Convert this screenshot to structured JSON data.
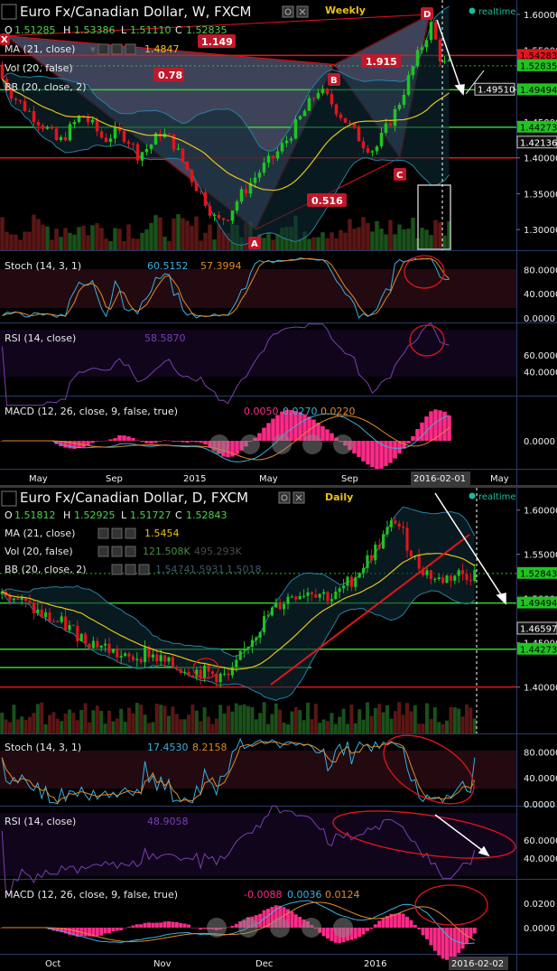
{
  "colors": {
    "background": "#000000",
    "panel_border": "#2b3b66",
    "bull": "#21c321",
    "bear": "#e3141d",
    "ma": "#e8c21a",
    "bb": "#2a7fa0",
    "stoch_k": "#3ab0e0",
    "stoch_d": "#e08a2a",
    "rsi": "#7b3fb0",
    "macd_hist": "#ff2a88",
    "green_line": "#33d433",
    "red_line": "#e3141d",
    "pattern_fill": "#8d94c8",
    "realtime_dot": "#1abc9c"
  },
  "charts": [
    {
      "id": "weekly",
      "title": "Euro Fx/Canadian Dollar, W, FXCM",
      "timeframe_label": "Weekly",
      "realtime_label": "realtime",
      "ohlc": {
        "o_label": "O",
        "o": "1.51285",
        "h_label": "H",
        "h": "1.53386",
        "l_label": "L",
        "l": "1.51110",
        "c_label": "C",
        "c": "1.52835"
      },
      "indicators": {
        "ma": {
          "label": "MA (21, close)",
          "value": "1.4847"
        },
        "vol": {
          "label": "Vol (20, false)",
          "value": ""
        },
        "bb": {
          "label": "BB (20, close, 2)",
          "value": ""
        },
        "stoch": {
          "label": "Stoch (14, 3, 1)",
          "k": "60.5152",
          "d": "57.3994"
        },
        "rsi": {
          "label": "RSI (14, close)",
          "value": "58.5870"
        },
        "macd": {
          "label": "MACD (12, 26, close, 9, false, true)",
          "hist": "0.0050",
          "macd": "0.0270",
          "signal": "0.0220"
        }
      },
      "harmonic_labels": {
        "x": "X",
        "a": "A",
        "b": "B",
        "c": "C",
        "d": "D"
      },
      "ratios": {
        "xab": "0.78",
        "xad": "1.149",
        "bcd": "1.915",
        "abc": "0.516"
      },
      "price_axis": [
        "1.60000",
        "1.55000",
        "1.50000",
        "1.45000",
        "1.40000",
        "1.35000",
        "1.30000"
      ],
      "price_tags": [
        {
          "text": "1.54283",
          "kind": "red"
        },
        {
          "text": "1.52835",
          "kind": "green"
        },
        {
          "text": "1.49510",
          "kind": "white"
        },
        {
          "text": "1.49494",
          "kind": "green"
        },
        {
          "text": "1.44273",
          "kind": "green"
        },
        {
          "text": "1.42136",
          "kind": "white"
        }
      ],
      "stoch_axis": [
        "80.0000",
        "40.0000",
        "0.0000"
      ],
      "rsi_axis": [
        "60.0000",
        "40.0000"
      ],
      "macd_axis": [
        "0.0000"
      ],
      "time_axis": [
        "May",
        "Sep",
        "2015",
        "May",
        "Sep",
        "2016-02-01",
        "May"
      ],
      "chart_data": {
        "type": "candlestick",
        "ylim": [
          1.28,
          1.61
        ],
        "ohlc_overview": [
          [
            1.53,
            1.535,
            1.5,
            1.51
          ],
          [
            1.51,
            1.512,
            1.48,
            1.485
          ],
          [
            1.485,
            1.49,
            1.46,
            1.47
          ],
          [
            1.47,
            1.48,
            1.445,
            1.455
          ],
          [
            1.455,
            1.465,
            1.43,
            1.44
          ],
          [
            1.44,
            1.45,
            1.41,
            1.42
          ],
          [
            1.42,
            1.445,
            1.41,
            1.44
          ],
          [
            1.44,
            1.47,
            1.43,
            1.46
          ],
          [
            1.46,
            1.47,
            1.44,
            1.445
          ],
          [
            1.445,
            1.45,
            1.42,
            1.425
          ],
          [
            1.425,
            1.44,
            1.41,
            1.435
          ],
          [
            1.435,
            1.45,
            1.42,
            1.43
          ],
          [
            1.43,
            1.44,
            1.4,
            1.405
          ],
          [
            1.405,
            1.42,
            1.39,
            1.415
          ],
          [
            1.415,
            1.44,
            1.41,
            1.435
          ],
          [
            1.435,
            1.45,
            1.42,
            1.425
          ],
          [
            1.425,
            1.43,
            1.39,
            1.395
          ],
          [
            1.395,
            1.4,
            1.36,
            1.365
          ],
          [
            1.365,
            1.37,
            1.33,
            1.34
          ],
          [
            1.34,
            1.35,
            1.3,
            1.31
          ],
          [
            1.31,
            1.33,
            1.295,
            1.32
          ],
          [
            1.32,
            1.35,
            1.31,
            1.345
          ],
          [
            1.345,
            1.37,
            1.33,
            1.365
          ],
          [
            1.365,
            1.39,
            1.36,
            1.385
          ],
          [
            1.385,
            1.41,
            1.37,
            1.4
          ],
          [
            1.4,
            1.43,
            1.39,
            1.42
          ],
          [
            1.42,
            1.45,
            1.41,
            1.445
          ],
          [
            1.445,
            1.48,
            1.44,
            1.47
          ],
          [
            1.47,
            1.5,
            1.46,
            1.495
          ],
          [
            1.495,
            1.51,
            1.47,
            1.48
          ],
          [
            1.48,
            1.49,
            1.45,
            1.46
          ],
          [
            1.46,
            1.47,
            1.43,
            1.44
          ],
          [
            1.44,
            1.45,
            1.41,
            1.42
          ],
          [
            1.42,
            1.43,
            1.4,
            1.41
          ],
          [
            1.41,
            1.45,
            1.405,
            1.44
          ],
          [
            1.44,
            1.48,
            1.43,
            1.47
          ],
          [
            1.47,
            1.52,
            1.46,
            1.51
          ],
          [
            1.51,
            1.56,
            1.5,
            1.55
          ],
          [
            1.55,
            1.6,
            1.53,
            1.585
          ],
          [
            1.585,
            1.595,
            1.52,
            1.53
          ]
        ]
      }
    },
    {
      "id": "daily",
      "title": "Euro Fx/Canadian Dollar, D, FXCM",
      "timeframe_label": "Daily",
      "realtime_label": "realtime",
      "ohlc": {
        "o_label": "O",
        "o": "1.51812",
        "h_label": "H",
        "h": "1.52925",
        "l_label": "L",
        "l": "1.51727",
        "c_label": "C",
        "c": "1.52843"
      },
      "indicators": {
        "ma": {
          "label": "MA (21, close)",
          "value": "1.5454"
        },
        "vol": {
          "label": "Vol (20, false)",
          "value": "121.508K",
          "value2": "495.293K"
        },
        "bb": {
          "label": "BB (20, close, 2)",
          "value": "1.5474",
          "value2": "1.5931",
          "value3": "1.5018"
        },
        "stoch": {
          "label": "Stoch (14, 3, 1)",
          "k": "17.4530",
          "d": "8.2158"
        },
        "rsi": {
          "label": "RSI (14, close)",
          "value": "48.9058"
        },
        "macd": {
          "label": "MACD (12, 26, close, 9, false, true)",
          "hist": "-0.0088",
          "macd": "0.0036",
          "signal": "0.0124"
        }
      },
      "price_axis": [
        "1.60000",
        "1.55000",
        "1.50000",
        "1.45000",
        "1.40000"
      ],
      "price_tags": [
        {
          "text": "1.52843",
          "kind": "green"
        },
        {
          "text": "1.49494",
          "kind": "green"
        },
        {
          "text": "1.46597",
          "kind": "white"
        },
        {
          "text": "1.44273",
          "kind": "green"
        }
      ],
      "stoch_axis": [
        "80.0000",
        "40.0000",
        "0.0000"
      ],
      "rsi_axis": [
        "60.0000",
        "40.0000"
      ],
      "macd_axis": [
        "0.0200",
        "0.0000"
      ],
      "time_axis": [
        "Oct",
        "Nov",
        "Dec",
        "2016",
        "2016-02-02"
      ],
      "chart_data": {
        "type": "candlestick",
        "ylim": [
          1.37,
          1.615
        ],
        "ohlc_overview": [
          [
            1.505,
            1.52,
            1.5,
            1.515
          ],
          [
            1.515,
            1.525,
            1.49,
            1.495
          ],
          [
            1.495,
            1.5,
            1.47,
            1.48
          ],
          [
            1.48,
            1.49,
            1.465,
            1.47
          ],
          [
            1.47,
            1.475,
            1.45,
            1.455
          ],
          [
            1.455,
            1.46,
            1.44,
            1.445
          ],
          [
            1.445,
            1.45,
            1.425,
            1.43
          ],
          [
            1.43,
            1.445,
            1.42,
            1.44
          ],
          [
            1.44,
            1.45,
            1.42,
            1.425
          ],
          [
            1.425,
            1.43,
            1.415,
            1.42
          ],
          [
            1.42,
            1.425,
            1.41,
            1.415
          ],
          [
            1.415,
            1.42,
            1.405,
            1.41
          ],
          [
            1.41,
            1.46,
            1.405,
            1.455
          ],
          [
            1.455,
            1.49,
            1.45,
            1.485
          ],
          [
            1.485,
            1.51,
            1.48,
            1.505
          ],
          [
            1.505,
            1.52,
            1.49,
            1.51
          ],
          [
            1.51,
            1.52,
            1.495,
            1.5
          ],
          [
            1.5,
            1.53,
            1.495,
            1.525
          ],
          [
            1.525,
            1.56,
            1.52,
            1.555
          ],
          [
            1.555,
            1.6,
            1.55,
            1.59
          ],
          [
            1.59,
            1.605,
            1.53,
            1.54
          ],
          [
            1.54,
            1.55,
            1.51,
            1.52
          ],
          [
            1.52,
            1.53,
            1.505,
            1.528
          ]
        ]
      }
    }
  ]
}
